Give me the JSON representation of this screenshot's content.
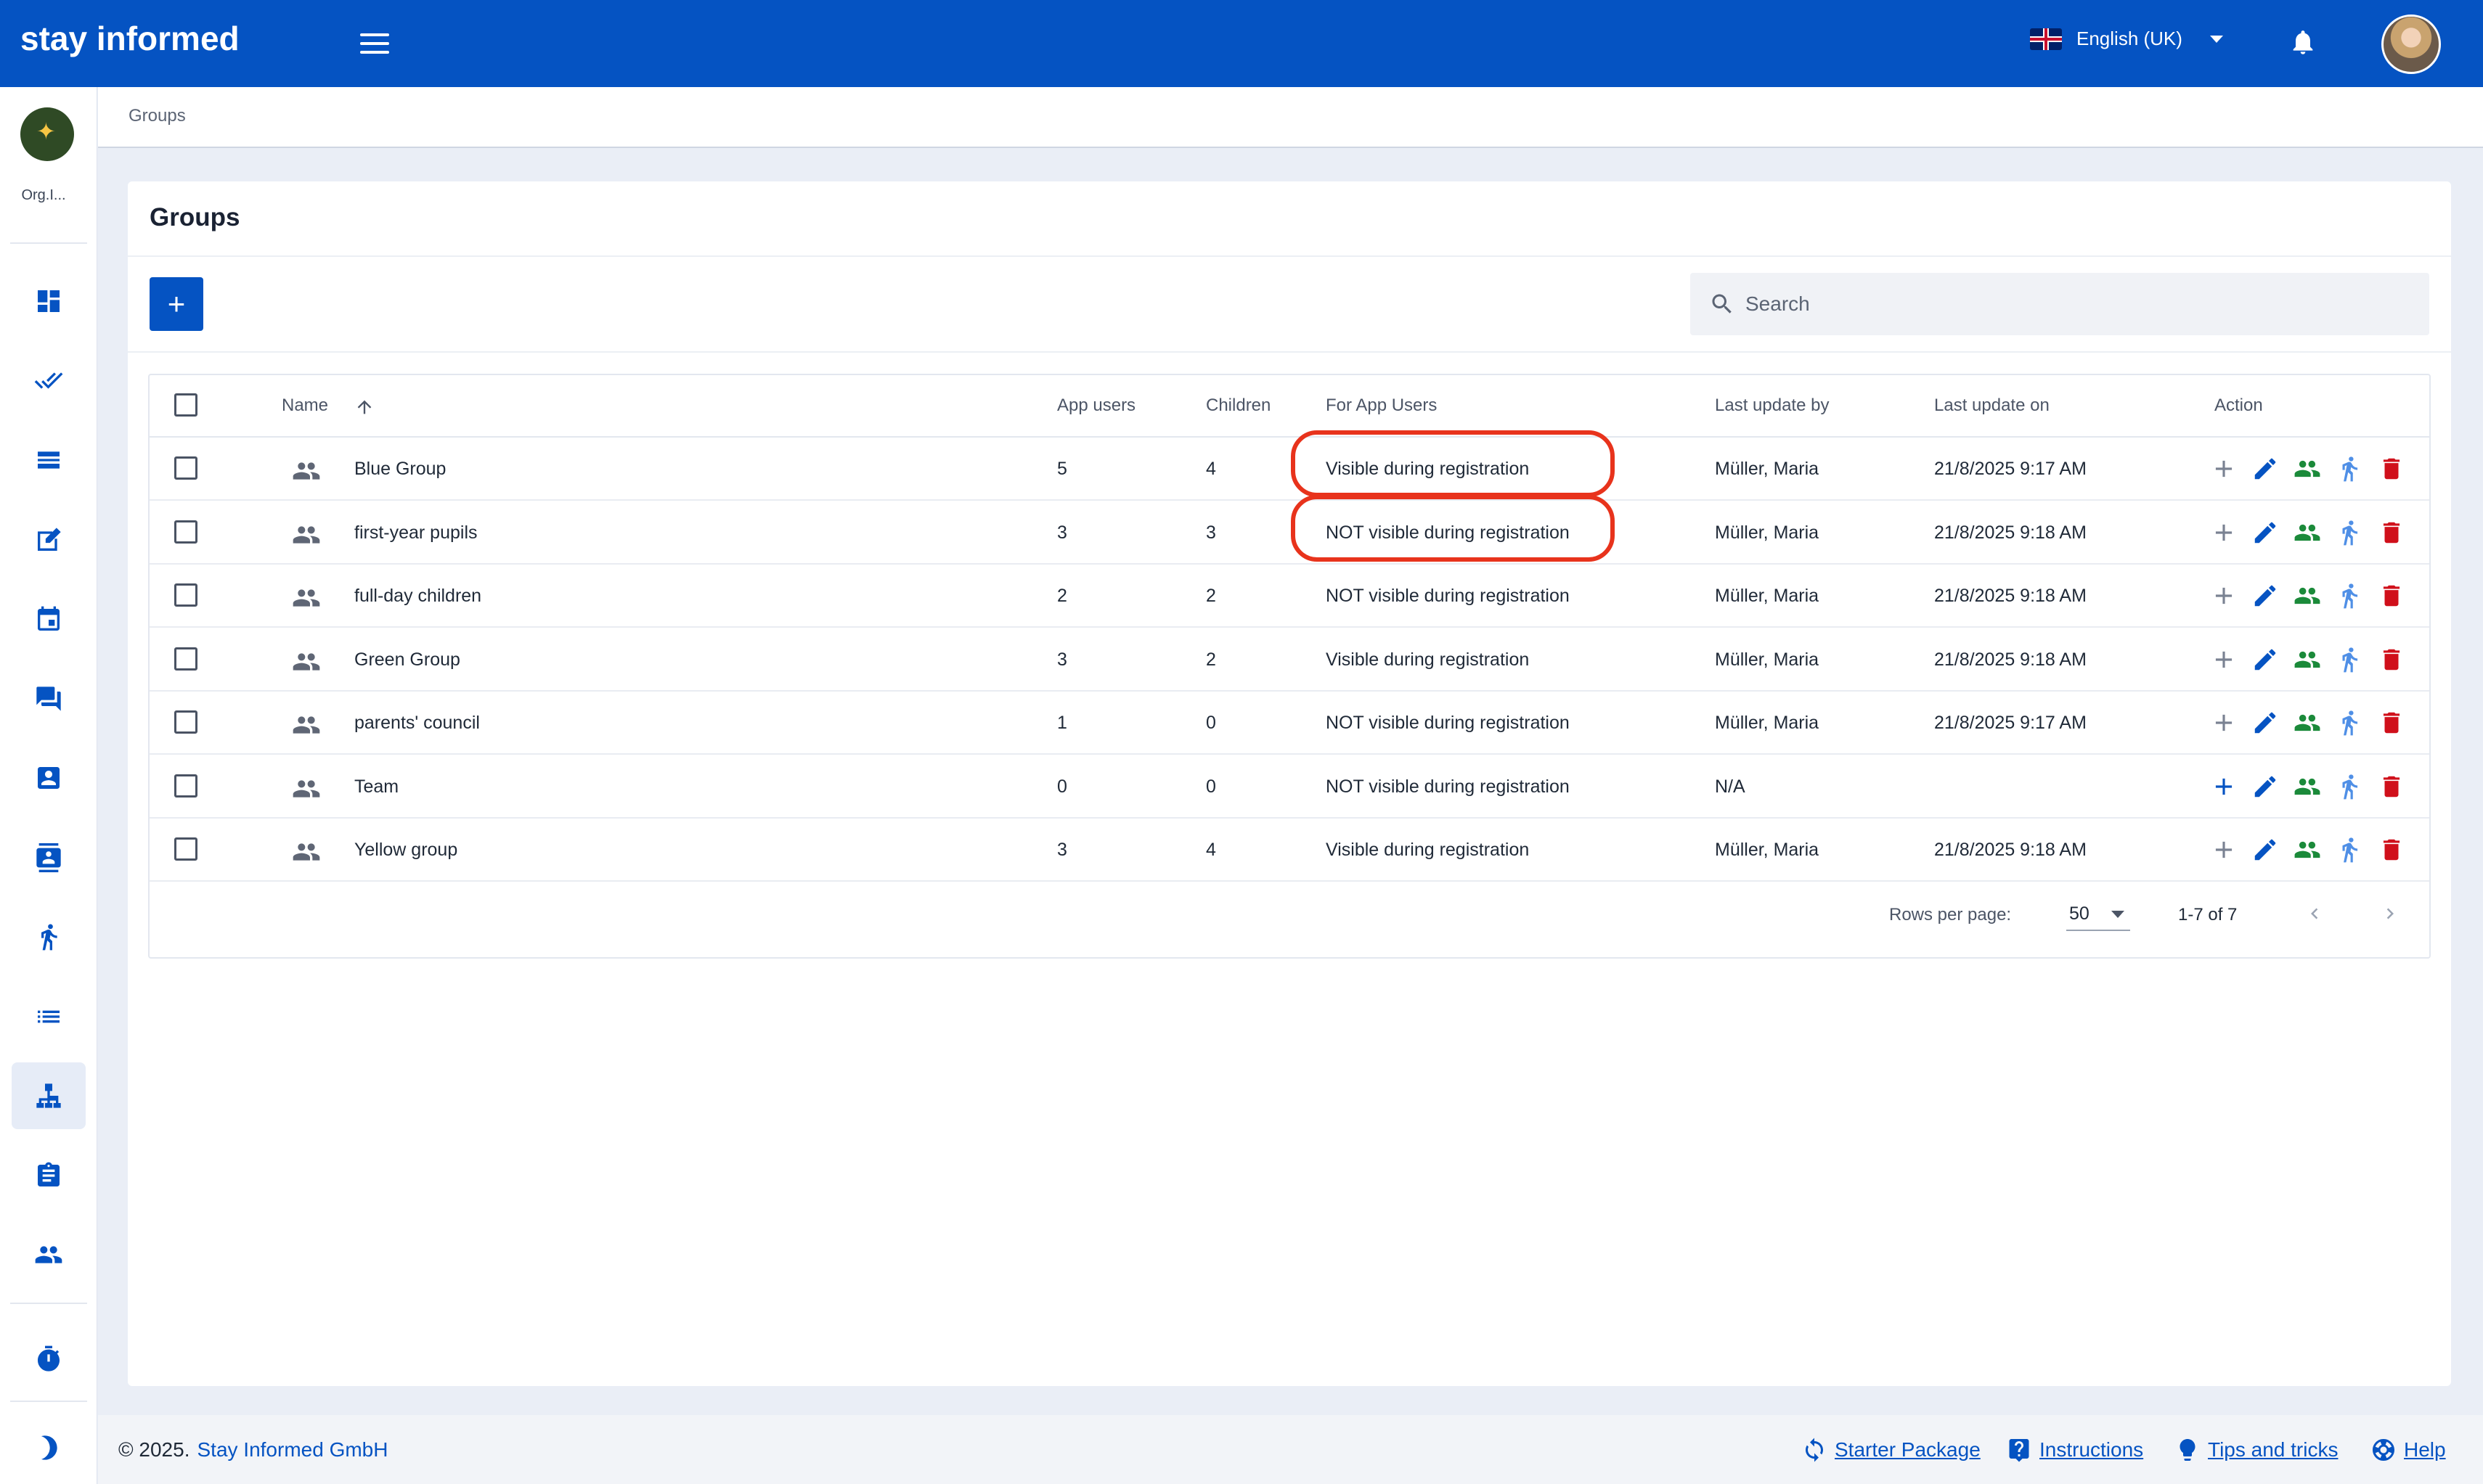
{
  "app": {
    "brand": "stay informed"
  },
  "header": {
    "language": "English (UK)",
    "icons": [
      "menu-icon",
      "uk-flag-icon",
      "chevron-down-icon",
      "bell-icon",
      "user-avatar"
    ]
  },
  "sidebar": {
    "org_label": "Org.I...",
    "items": [
      "dashboard-icon",
      "done-all-icon",
      "news-list-icon",
      "edit-note-icon",
      "calendar-icon",
      "chat-icon",
      "contact-card-icon",
      "contact-list-icon",
      "child-icon",
      "list-icon",
      "groups-hierarchy-icon",
      "clipboard-icon",
      "people-icon",
      "timer-icon",
      "dark-mode-icon"
    ],
    "active_item": "groups-hierarchy-icon"
  },
  "breadcrumb": {
    "current": "Groups"
  },
  "page": {
    "title": "Groups",
    "add_label": "+",
    "search_placeholder": "Search"
  },
  "table": {
    "columns": {
      "name": "Name",
      "app_users": "App users",
      "children": "Children",
      "for_app_users": "For App Users",
      "last_update_by": "Last update by",
      "last_update_on": "Last update on",
      "action": "Action"
    },
    "rows": [
      {
        "name": "Blue Group",
        "app_users": "5",
        "children": "4",
        "for_app_users": "Visible during registration",
        "last_update_by": "Müller, Maria",
        "last_update_on": "21/8/2025 9:17 AM"
      },
      {
        "name": "first-year pupils",
        "app_users": "3",
        "children": "3",
        "for_app_users": "NOT visible during registration",
        "last_update_by": "Müller, Maria",
        "last_update_on": "21/8/2025 9:18 AM"
      },
      {
        "name": "full-day children",
        "app_users": "2",
        "children": "2",
        "for_app_users": "NOT visible during registration",
        "last_update_by": "Müller, Maria",
        "last_update_on": "21/8/2025 9:18 AM"
      },
      {
        "name": "Green Group",
        "app_users": "3",
        "children": "2",
        "for_app_users": "Visible during registration",
        "last_update_by": "Müller, Maria",
        "last_update_on": "21/8/2025 9:18 AM"
      },
      {
        "name": "parents' council",
        "app_users": "1",
        "children": "0",
        "for_app_users": "NOT visible during registration",
        "last_update_by": "Müller, Maria",
        "last_update_on": "21/8/2025 9:17 AM"
      },
      {
        "name": "Team",
        "app_users": "0",
        "children": "0",
        "for_app_users": "NOT visible during registration",
        "last_update_by": "N/A",
        "last_update_on": ""
      },
      {
        "name": "Yellow group",
        "app_users": "3",
        "children": "4",
        "for_app_users": "Visible during registration",
        "last_update_by": "Müller, Maria",
        "last_update_on": "21/8/2025 9:18 AM"
      }
    ],
    "highlighted_cells": [
      "Blue Group: For App Users",
      "first-year pupils: For App Users"
    ]
  },
  "pagination": {
    "rows_per_page_label": "Rows per page:",
    "rows_per_page_value": "50",
    "range": "1-7 of 7"
  },
  "footer": {
    "copyright": "© 2025.",
    "company": "Stay Informed GmbH",
    "links": {
      "starter_package": "Starter Package",
      "instructions": "Instructions",
      "tips": "Tips and tricks",
      "help": "Help"
    }
  },
  "colors": {
    "primary": "#0553c2",
    "edit_icon": "#0553c2",
    "members_icon": "#1b8a3a",
    "children_icon": "#4f8fe6",
    "delete_icon": "#d0101b",
    "highlight_ring": "#e8331c"
  }
}
